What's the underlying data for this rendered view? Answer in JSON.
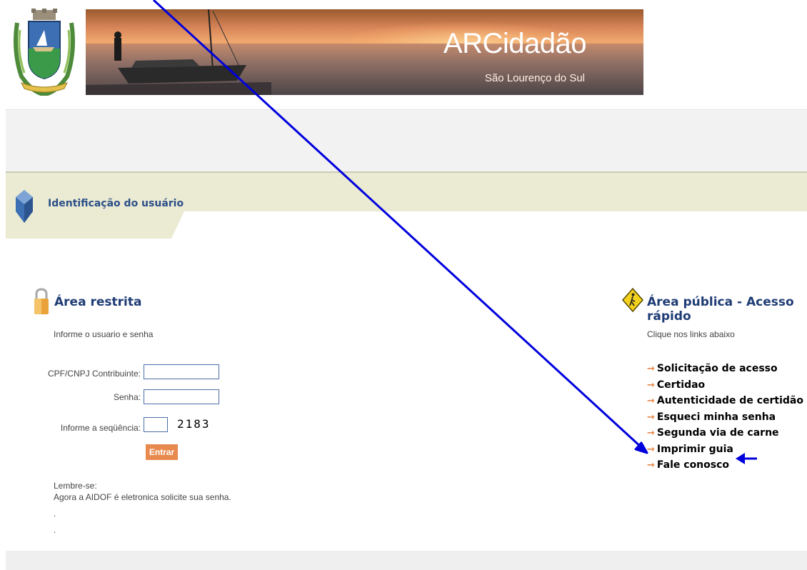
{
  "header": {
    "title": "ARCidadão",
    "subtitle": "São Lourenço do Sul"
  },
  "section": {
    "title": "Identificação do usuário"
  },
  "restricted": {
    "heading": "Área restrita",
    "instruction": "Informe o usuario e senha",
    "fields": {
      "cpf_label": "CPF/CNPJ Contribuinte:",
      "cpf_value": "",
      "password_label": "Senha:",
      "password_value": "",
      "sequence_label": "Informe a seqüência:",
      "sequence_value": ""
    },
    "captcha": "2183",
    "submit_label": "Entrar",
    "reminder_title": "Lembre-se:",
    "reminder_text": "Agora a AIDOF é eletronica solicite sua senha.",
    "dot1": ".",
    "dot2": "."
  },
  "public": {
    "heading": "Área pública - Acesso rápido",
    "instruction": "Clique nos links abaixo",
    "links": [
      "Solicitação de acesso",
      "Certidao",
      "Autenticidade de certidão",
      "Esqueci minha senha",
      "Segunda via de carne",
      "Imprimir guia",
      "Fale conosco"
    ]
  },
  "colors": {
    "accent": "#e8894e",
    "annotation": "#0000dd",
    "heading": "#1e3c74",
    "band": "#ebebd3"
  }
}
